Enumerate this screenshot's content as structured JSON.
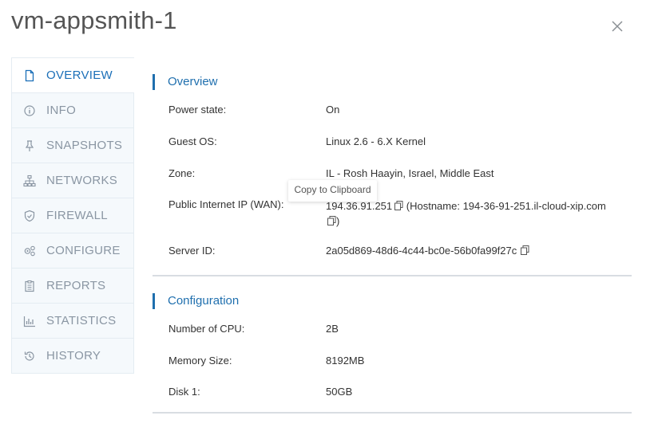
{
  "window": {
    "title": "vm-appsmith-1",
    "close_icon": "close-icon"
  },
  "sidebar": {
    "items": [
      {
        "label": "OVERVIEW",
        "icon": "document-icon",
        "active": true
      },
      {
        "label": "INFO",
        "icon": "info-icon",
        "active": false
      },
      {
        "label": "SNAPSHOTS",
        "icon": "pin-icon",
        "active": false
      },
      {
        "label": "NETWORKS",
        "icon": "network-icon",
        "active": false
      },
      {
        "label": "FIREWALL",
        "icon": "shield-icon",
        "active": false
      },
      {
        "label": "CONFIGURE",
        "icon": "gears-icon",
        "active": false
      },
      {
        "label": "REPORTS",
        "icon": "clipboard-icon",
        "active": false
      },
      {
        "label": "STATISTICS",
        "icon": "chart-icon",
        "active": false
      },
      {
        "label": "HISTORY",
        "icon": "history-icon",
        "active": false
      }
    ]
  },
  "overview": {
    "heading": "Overview",
    "power_label": "Power state:",
    "power_value": "On",
    "os_label": "Guest OS:",
    "os_value": "Linux 2.6 - 6.X Kernel",
    "zone_label": "Zone:",
    "zone_value": "IL - Rosh Haayin, Israel, Middle East",
    "ip_label": "Public Internet IP (WAN):",
    "ip_value": "194.36.91.251",
    "hostname_value": "(Hostname: 194-36-91-251.il-cloud-xip.com",
    "hostname_close": ")",
    "server_label": "Server ID:",
    "server_value": "2a05d869-48d6-4c44-bc0e-56b0fa99f27c"
  },
  "configuration": {
    "heading": "Configuration",
    "cpu_label": "Number of CPU:",
    "cpu_value": "2B",
    "memory_label": "Memory Size:",
    "memory_value": "8192MB",
    "disk_label": "Disk 1:",
    "disk_value": "50GB"
  },
  "tooltip": {
    "text": "Copy to Clipboard"
  },
  "colors": {
    "accent": "#1f6fae",
    "active_nav": "#1b6fb8",
    "nav_text": "#8a96a3",
    "nav_bg": "#f5f9fc"
  }
}
